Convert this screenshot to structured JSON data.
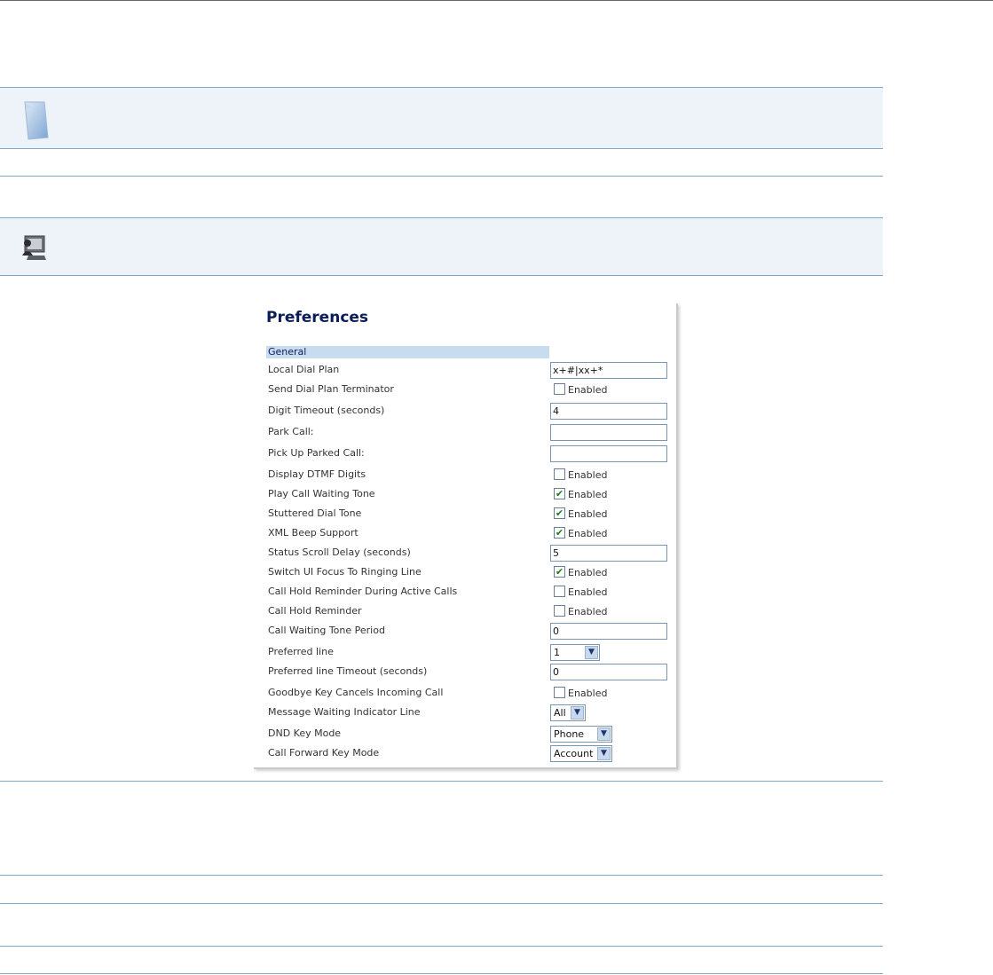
{
  "dialog": {
    "title": "Preferences",
    "section": "General",
    "rows": [
      {
        "label": "Local Dial Plan",
        "type": "text",
        "value": "x+#|xx+*"
      },
      {
        "label": "Send Dial Plan Terminator",
        "type": "checkbox",
        "checked": false,
        "check_label": "Enabled"
      },
      {
        "label": "Digit Timeout (seconds)",
        "type": "text",
        "value": "4"
      },
      {
        "label": "Park Call:",
        "type": "text",
        "value": ""
      },
      {
        "label": "Pick Up Parked Call:",
        "type": "text",
        "value": ""
      },
      {
        "label": "Display DTMF Digits",
        "type": "checkbox",
        "checked": false,
        "check_label": "Enabled"
      },
      {
        "label": "Play Call Waiting Tone",
        "type": "checkbox",
        "checked": true,
        "check_label": "Enabled"
      },
      {
        "label": "Stuttered Dial Tone",
        "type": "checkbox",
        "checked": true,
        "check_label": "Enabled"
      },
      {
        "label": "XML Beep Support",
        "type": "checkbox",
        "checked": true,
        "check_label": "Enabled"
      },
      {
        "label": "Status Scroll Delay (seconds)",
        "type": "text",
        "value": "5"
      },
      {
        "label": "Switch UI Focus To Ringing Line",
        "type": "checkbox",
        "checked": true,
        "check_label": "Enabled"
      },
      {
        "label": "Call Hold Reminder During Active Calls",
        "type": "checkbox",
        "checked": false,
        "check_label": "Enabled"
      },
      {
        "label": "Call Hold Reminder",
        "type": "checkbox",
        "checked": false,
        "check_label": "Enabled"
      },
      {
        "label": "Call Waiting Tone Period",
        "type": "text",
        "value": "0"
      },
      {
        "label": "Preferred line",
        "type": "select",
        "value": "1"
      },
      {
        "label": "Preferred line Timeout (seconds)",
        "type": "text",
        "value": "0"
      },
      {
        "label": "Goodbye Key Cancels Incoming Call",
        "type": "checkbox",
        "checked": false,
        "check_label": "Enabled"
      },
      {
        "label": "Message Waiting Indicator Line",
        "type": "select",
        "value": "All"
      },
      {
        "label": "DND Key Mode",
        "type": "select",
        "value": "Phone"
      },
      {
        "label": "Call Forward Key Mode",
        "type": "select",
        "value": "Account"
      }
    ]
  },
  "icons": {
    "note": "note-page-icon",
    "computer": "computer-user-icon",
    "dropdown": "chevron-down-icon",
    "checkmark": "checkmark-icon"
  },
  "colors": {
    "rule": "#7fa7cf",
    "band_bg": "#eef3f9",
    "title": "#0b1c5a",
    "section_bar": "#c8dcef",
    "check": "#1a7b1a"
  }
}
